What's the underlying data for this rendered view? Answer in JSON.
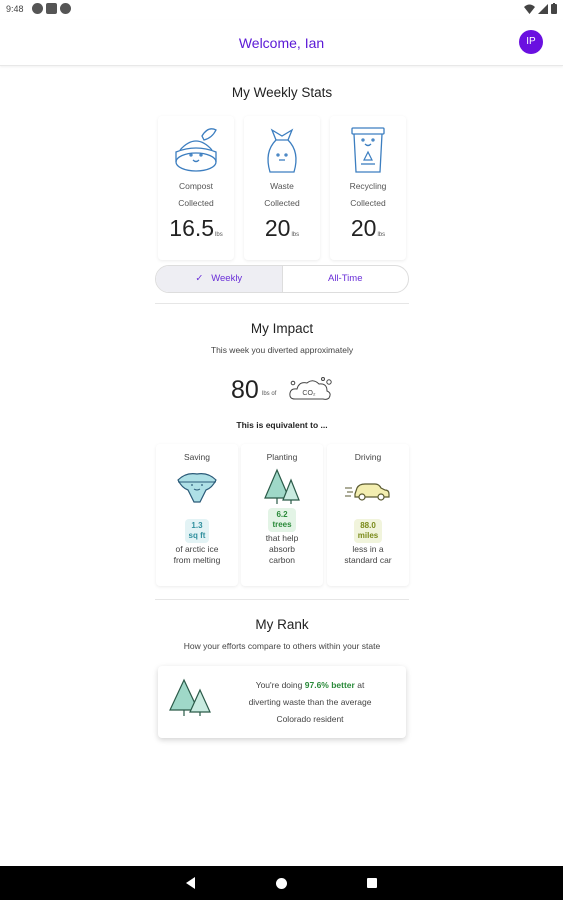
{
  "status_bar": {
    "time": "9:48",
    "icons": [
      "a-icon",
      "sim-icon",
      "p-icon"
    ],
    "right_icons": [
      "wifi-icon",
      "signal-icon",
      "battery-icon"
    ]
  },
  "app_bar": {
    "title": "Welcome, Ian",
    "avatar_initials": "IP"
  },
  "weekly_stats": {
    "title": "My Weekly Stats",
    "cards": [
      {
        "icon": "compost-icon",
        "label_line1": "Compost",
        "label_line2": "Collected",
        "value": "16.5",
        "unit": "lbs"
      },
      {
        "icon": "waste-bag-icon",
        "label_line1": "Waste",
        "label_line2": "Collected",
        "value": "20",
        "unit": "lbs"
      },
      {
        "icon": "recycling-bin-icon",
        "label_line1": "Recycling",
        "label_line2": "Collected",
        "value": "20",
        "unit": "lbs"
      }
    ],
    "toggle": {
      "options": [
        "Weekly",
        "All-Time"
      ],
      "selected": "Weekly",
      "check": "✓"
    }
  },
  "impact": {
    "title": "My Impact",
    "subtitle": "This week you diverted approximately",
    "amount": "80",
    "unit_label": "lbs of",
    "co2_label": "CO₂",
    "equivalent_label": "This is equivalent to ...",
    "cards": [
      {
        "caption": "Saving",
        "icon": "iceberg-icon",
        "badge_line1": "1.3",
        "badge_line2": "sq ft",
        "badge_color": "#2f8f9d",
        "badge_bg": "#e3f3f5",
        "desc_line1": "of arctic ice",
        "desc_line2": "from melting",
        "desc_line3": ""
      },
      {
        "caption": "Planting",
        "icon": "trees-icon",
        "badge_line1": "6.2",
        "badge_line2": "trees",
        "badge_color": "#2a8a3a",
        "badge_bg": "#e3f4e6",
        "desc_line1": "that help",
        "desc_line2": "absorb",
        "desc_line3": "carbon"
      },
      {
        "caption": "Driving",
        "icon": "car-icon",
        "badge_line1": "88.0",
        "badge_line2": "miles",
        "badge_color": "#7a8a1a",
        "badge_bg": "#f1f4dc",
        "desc_line1": "less in a",
        "desc_line2": "standard car",
        "desc_line3": ""
      }
    ]
  },
  "rank": {
    "title": "My Rank",
    "subtitle": "How your efforts compare to others within your state",
    "line1_pre": "You're doing",
    "highlight": "97.6% better",
    "line1_post": "at",
    "line2": "diverting waste than the average",
    "line3": "Colorado resident"
  },
  "colors": {
    "brand": "#5a18d6",
    "icon_stroke": "#3c7ec0",
    "tree_fill": "#9fd8c8"
  }
}
